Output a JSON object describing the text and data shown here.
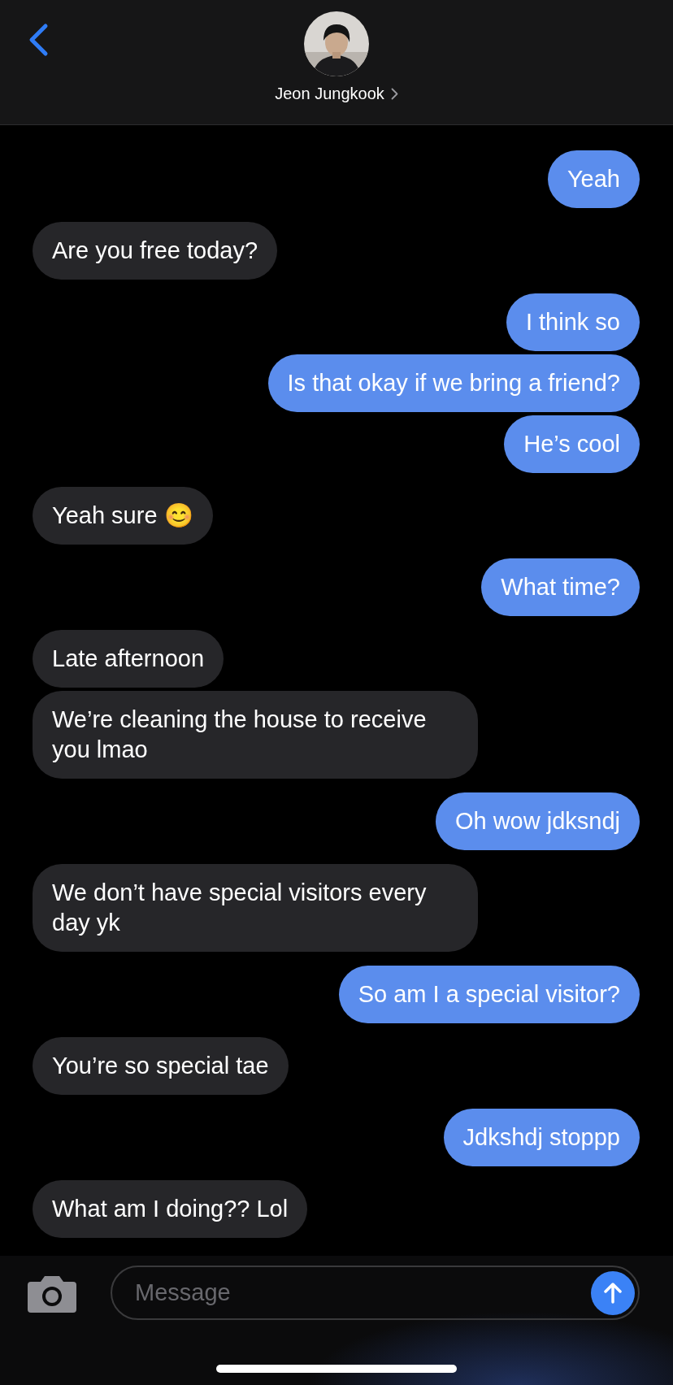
{
  "header": {
    "contact_name": "Jeon Jungkook"
  },
  "messages": [
    {
      "kind": "sent",
      "text": "Yeah"
    },
    {
      "kind": "received",
      "text": "Are you free today?"
    },
    {
      "kind": "sent",
      "text": "I think so"
    },
    {
      "kind": "sent",
      "text": "Is that okay if we bring a friend?"
    },
    {
      "kind": "sent",
      "text": "He’s cool"
    },
    {
      "kind": "received",
      "text": "Yeah sure 😊"
    },
    {
      "kind": "sent",
      "text": "What time?"
    },
    {
      "kind": "received",
      "text": "Late afternoon"
    },
    {
      "kind": "received",
      "text": "We’re cleaning the house to receive you lmao"
    },
    {
      "kind": "sent",
      "text": "Oh wow jdksndj"
    },
    {
      "kind": "received",
      "text": "We don’t have special visitors every day yk"
    },
    {
      "kind": "sent",
      "text": "So am I a special visitor?"
    },
    {
      "kind": "received",
      "text": "You’re so special tae"
    },
    {
      "kind": "sent",
      "text": "Jdkshdj stoppp"
    },
    {
      "kind": "received",
      "text": "What am I doing?? Lol"
    }
  ],
  "composer": {
    "placeholder": "Message"
  }
}
